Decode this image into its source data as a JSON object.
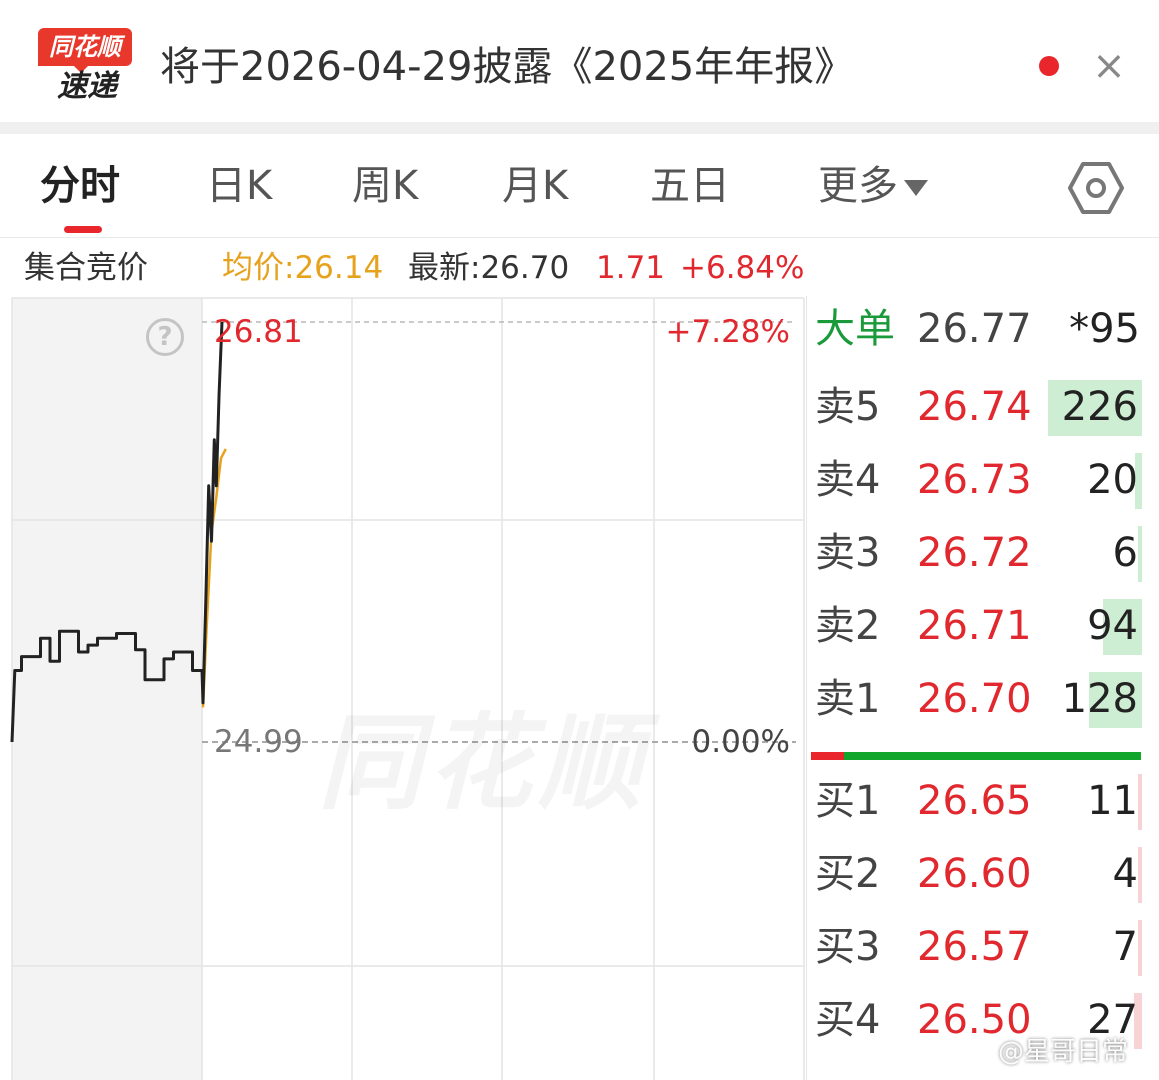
{
  "banner": {
    "logo_top": "同花顺",
    "logo_bottom": "速递",
    "title": "将于2026-04-29披露《2025年年报》",
    "close_icon": "close-icon"
  },
  "tabs": [
    {
      "label": "分时",
      "active": true
    },
    {
      "label": "日K",
      "active": false
    },
    {
      "label": "周K",
      "active": false
    },
    {
      "label": "月K",
      "active": false
    },
    {
      "label": "五日",
      "active": false
    },
    {
      "label": "更多",
      "active": false
    }
  ],
  "settings_icon": "hexagon-settings-icon",
  "info": {
    "mode": "集合竞价",
    "avg": "均价:26.14",
    "latest": "最新:26.70",
    "change": "1.71",
    "change_pct": "+6.84%"
  },
  "chart": {
    "high_label": "26.81",
    "high_pct": "+7.28%",
    "base_label": "24.99",
    "base_pct": "0.00%",
    "watermark": "同花顺",
    "colors": {
      "price": "#222222",
      "avg": "#e6a21c",
      "up": "#e0282e"
    }
  },
  "chart_data": {
    "type": "line",
    "prev_close": 24.99,
    "ylim": [
      24.99,
      26.81
    ],
    "series": [
      {
        "name": "price",
        "points": [
          [
            0,
            24.99
          ],
          [
            0.3,
            25.3
          ],
          [
            1,
            25.3
          ],
          [
            1,
            25.36
          ],
          [
            3,
            25.36
          ],
          [
            3,
            25.44
          ],
          [
            4,
            25.44
          ],
          [
            4,
            25.34
          ],
          [
            5,
            25.34
          ],
          [
            5,
            25.47
          ],
          [
            7,
            25.47
          ],
          [
            7,
            25.38
          ],
          [
            8,
            25.38
          ],
          [
            8,
            25.41
          ],
          [
            9,
            25.41
          ],
          [
            9,
            25.44
          ],
          [
            11,
            25.44
          ],
          [
            11,
            25.46
          ],
          [
            13,
            25.46
          ],
          [
            13,
            25.39
          ],
          [
            14,
            25.39
          ],
          [
            14,
            25.26
          ],
          [
            16,
            25.26
          ],
          [
            16,
            25.35
          ],
          [
            17,
            25.35
          ],
          [
            17,
            25.38
          ],
          [
            19,
            25.38
          ],
          [
            19,
            25.3
          ],
          [
            20,
            25.3
          ],
          [
            20.1,
            25.16
          ],
          [
            20.4,
            25.6
          ],
          [
            20.7,
            26.1
          ],
          [
            21.0,
            25.86
          ],
          [
            21.3,
            26.3
          ],
          [
            21.5,
            26.1
          ],
          [
            21.8,
            26.5
          ],
          [
            22.1,
            26.81
          ]
        ]
      },
      {
        "name": "avg",
        "points": [
          [
            20.1,
            25.14
          ],
          [
            20.5,
            25.5
          ],
          [
            21.0,
            25.9
          ],
          [
            21.5,
            26.05
          ],
          [
            22.0,
            26.22
          ],
          [
            22.5,
            26.26
          ]
        ]
      }
    ]
  },
  "book": {
    "big_order": {
      "label": "大单",
      "price": "26.77",
      "volume": "*95"
    },
    "asks": [
      {
        "label": "卖5",
        "price": "26.74",
        "volume": "226",
        "bar": 0.85
      },
      {
        "label": "卖4",
        "price": "26.73",
        "volume": "20",
        "bar": 0.06
      },
      {
        "label": "卖3",
        "price": "26.72",
        "volume": "6",
        "bar": 0.02
      },
      {
        "label": "卖2",
        "price": "26.71",
        "volume": "94",
        "bar": 0.35
      },
      {
        "label": "卖1",
        "price": "26.70",
        "volume": "128",
        "bar": 0.48
      }
    ],
    "bids": [
      {
        "label": "买1",
        "price": "26.65",
        "volume": "11",
        "bar": 0.03
      },
      {
        "label": "买2",
        "price": "26.60",
        "volume": "4",
        "bar": 0.01
      },
      {
        "label": "买3",
        "price": "26.57",
        "volume": "7",
        "bar": 0.02
      },
      {
        "label": "买4",
        "price": "26.50",
        "volume": "27",
        "bar": 0.07
      }
    ],
    "ratio_buy": 0.1
  },
  "credit": "@星哥日常"
}
